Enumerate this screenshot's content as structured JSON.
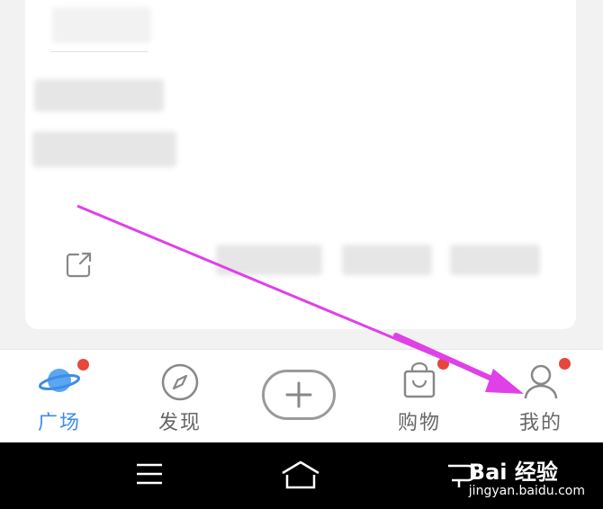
{
  "card": {
    "blurred_line_1": "《暗恋》",
    "blurred_line_2": "人物资质",
    "share_icon": "share-icon",
    "stats": [
      "",
      "",
      ""
    ]
  },
  "tabbar": {
    "tabs": [
      {
        "label": "广场",
        "icon": "planet-icon",
        "active": true,
        "badge": true
      },
      {
        "label": "发现",
        "icon": "compass-icon",
        "active": false,
        "badge": false
      },
      {
        "label": "",
        "icon": "plus-icon",
        "active": false,
        "badge": false
      },
      {
        "label": "购物",
        "icon": "shopping-bag-icon",
        "active": false,
        "badge": true
      },
      {
        "label": "我的",
        "icon": "user-icon",
        "active": false,
        "badge": true
      }
    ],
    "active_color": "#3d8de6",
    "badge_color": "#e8453c"
  },
  "navbar": {
    "buttons": [
      "menu-icon",
      "home-icon",
      "back-icon"
    ]
  },
  "watermark": {
    "main": "Bai 经验",
    "sub": "jingyan.baidu.com"
  },
  "annotation": {
    "arrow_color": "#e040e8"
  }
}
